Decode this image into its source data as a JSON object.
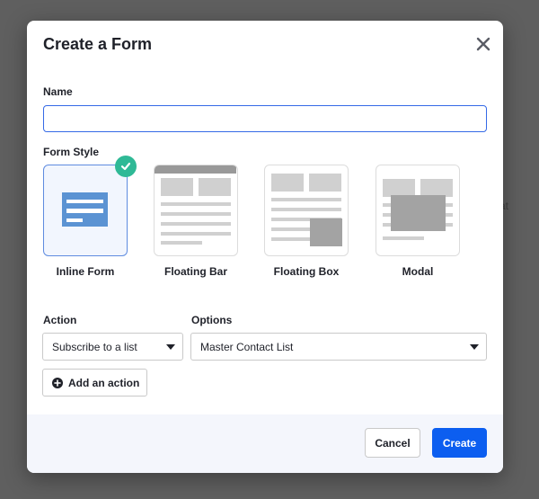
{
  "background": {
    "partial_text": "at"
  },
  "modal": {
    "title": "Create a Form",
    "close_icon": "close-icon"
  },
  "name_field": {
    "label": "Name",
    "value": "",
    "placeholder": ""
  },
  "form_style": {
    "label": "Form Style",
    "selected": "Inline Form",
    "options": [
      {
        "label": "Inline Form",
        "icon": "inline-form-icon",
        "selected": true
      },
      {
        "label": "Floating Bar",
        "icon": "floating-bar-icon",
        "selected": false
      },
      {
        "label": "Floating Box",
        "icon": "floating-box-icon",
        "selected": false
      },
      {
        "label": "Modal",
        "icon": "modal-icon",
        "selected": false
      }
    ],
    "check_icon": "check-icon"
  },
  "action": {
    "label": "Action",
    "selected": "Subscribe to a list"
  },
  "options": {
    "label": "Options",
    "selected": "Master Contact List"
  },
  "add_action": {
    "label": "Add an action",
    "icon": "plus-circle-icon"
  },
  "footer": {
    "cancel_label": "Cancel",
    "create_label": "Create"
  },
  "colors": {
    "primary": "#0c5ef0",
    "selected_border": "#5f8ce0",
    "check_badge": "#2fb996",
    "input_focus": "#356ae6",
    "overlay": "#5f5f5f"
  }
}
